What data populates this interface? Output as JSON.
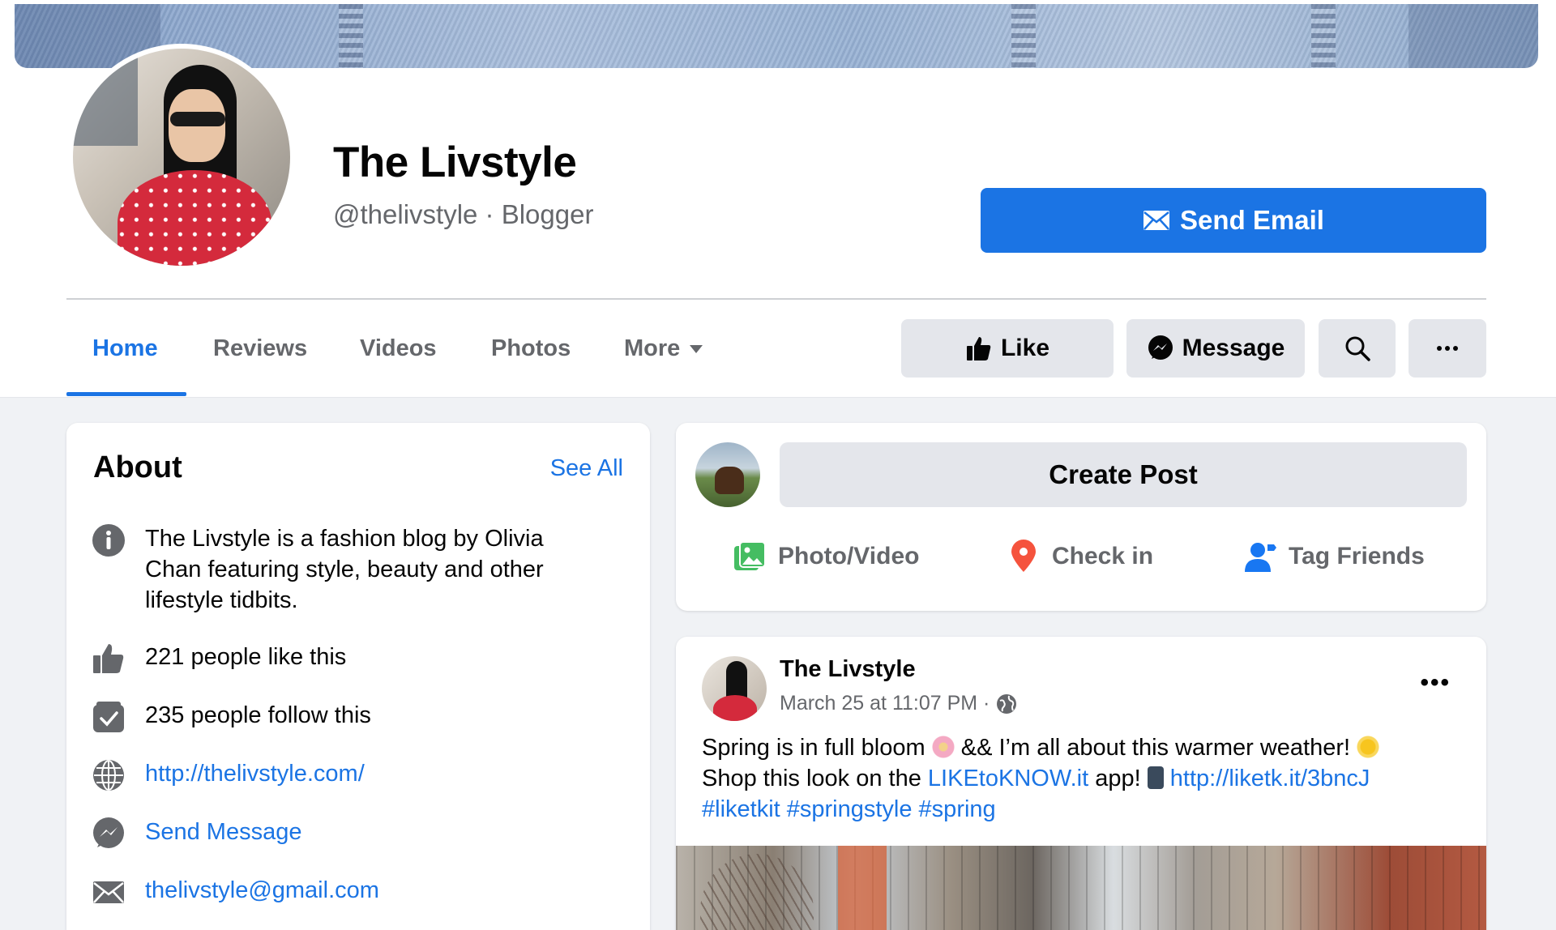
{
  "page": {
    "name": "The Livstyle",
    "subtitle": "@thelivstyle · Blogger",
    "send_email_label": "Send Email"
  },
  "tabs": [
    {
      "label": "Home",
      "active": true
    },
    {
      "label": "Reviews"
    },
    {
      "label": "Videos"
    },
    {
      "label": "Photos"
    },
    {
      "label": "More"
    }
  ],
  "actions": {
    "like_label": "Like",
    "message_label": "Message",
    "search_icon": "search-icon",
    "more_icon": "more-horizontal-icon"
  },
  "about": {
    "title": "About",
    "see_all": "See All",
    "description": "The Livstyle is a fashion blog by Olivia Chan featuring style, beauty and other lifestyle tidbits.",
    "likes": "221 people like this",
    "follows": "235 people follow this",
    "website": "http://thelivstyle.com/",
    "send_message": "Send Message",
    "email": "thelivstyle@gmail.com"
  },
  "composer": {
    "create_post": "Create Post",
    "photo_video": "Photo/Video",
    "check_in": "Check in",
    "tag_friends": "Tag Friends"
  },
  "post": {
    "author": "The Livstyle",
    "timestamp": "March 25 at 11:07 PM ·",
    "line1_a": "Spring is in full bloom ",
    "line1_b": " && I’m all about this warmer weather! ",
    "line2_a": "Shop this look on the ",
    "line2_link": "LIKEtoKNOW.it",
    "line2_b": " app! ",
    "line2_url": "http://liketk.it/3bncJ",
    "hashtags": "#liketkit #springstyle #spring"
  },
  "colors": {
    "accent": "#1b74e4",
    "secondary_text": "#65676b",
    "button_grey": "#e4e6eb",
    "feed_bg": "#f0f2f5"
  }
}
